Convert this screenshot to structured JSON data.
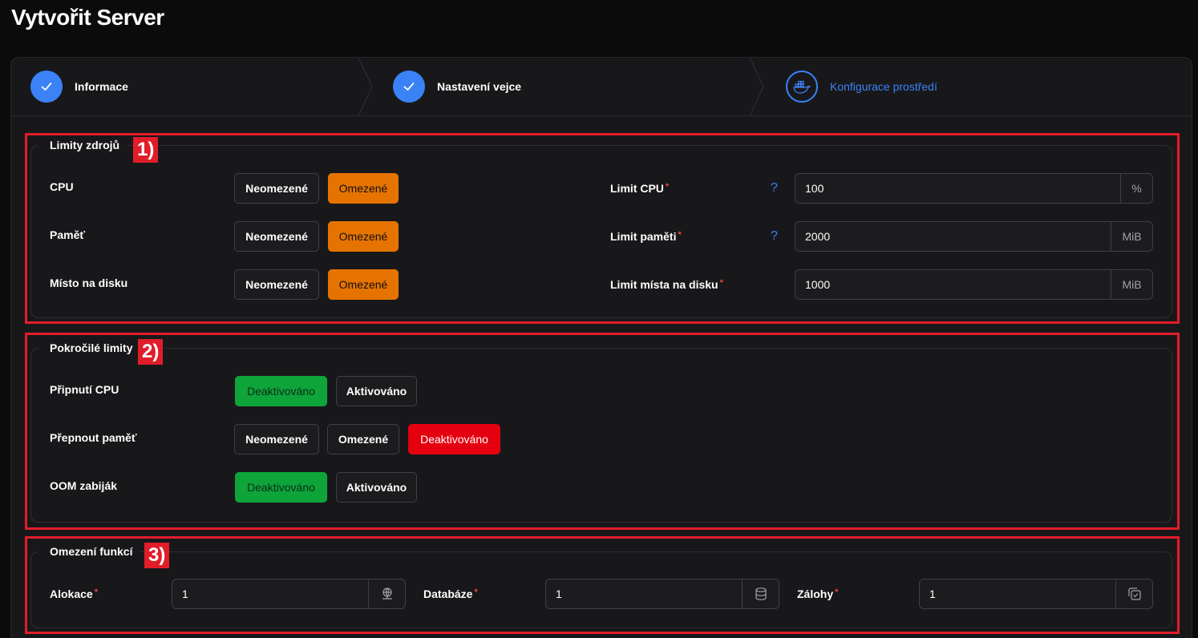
{
  "page_title": "Vytvořit Server",
  "steps": [
    {
      "label": "Informace",
      "status": "done",
      "icon": "check-icon"
    },
    {
      "label": "Nastavení vejce",
      "status": "done",
      "icon": "check-icon"
    },
    {
      "label": "Konfigurace prostředí",
      "status": "current",
      "icon": "docker-icon"
    }
  ],
  "annotations": {
    "one": "1)",
    "two": "2)",
    "three": "3)"
  },
  "resource_limits": {
    "legend": "Limity zdrojů",
    "rows": [
      {
        "label": "CPU",
        "unlimited": "Neomezené",
        "limited": "Omezené",
        "selected": "limited"
      },
      {
        "label": "Paměť",
        "unlimited": "Neomezené",
        "limited": "Omezené",
        "selected": "limited"
      },
      {
        "label": "Místo na disku",
        "unlimited": "Neomezené",
        "limited": "Omezené",
        "selected": "limited"
      }
    ],
    "fields": [
      {
        "label": "Limit CPU",
        "required": "*",
        "help": "?",
        "value": "100",
        "suffix": "%"
      },
      {
        "label": "Limit paměti",
        "required": "*",
        "help": "?",
        "value": "2000",
        "suffix": "MiB"
      },
      {
        "label": "Limit místa na disku",
        "required": "*",
        "help": "",
        "value": "1000",
        "suffix": "MiB"
      }
    ]
  },
  "advanced_limits": {
    "legend": "Pokročilé limity",
    "cpu_pinning": {
      "label": "Připnutí CPU",
      "opt1": "Deaktivováno",
      "opt2": "Aktivováno",
      "selected": "Deaktivováno"
    },
    "swap": {
      "label": "Přepnout paměť",
      "opt1": "Neomezené",
      "opt2": "Omezené",
      "opt3": "Deaktivováno",
      "selected": "Deaktivováno"
    },
    "oom": {
      "label": "OOM zabiják",
      "opt1": "Deaktivováno",
      "opt2": "Aktivováno",
      "selected": "Deaktivováno"
    }
  },
  "feature_limits": {
    "legend": "Omezení funkcí",
    "fields": [
      {
        "label": "Alokace",
        "required": "*",
        "value": "1",
        "icon": "network-icon"
      },
      {
        "label": "Databáze",
        "required": "*",
        "value": "1",
        "icon": "database-icon"
      },
      {
        "label": "Zálohy",
        "required": "*",
        "value": "1",
        "icon": "backup-icon"
      }
    ]
  },
  "colors": {
    "accent": "#3b82f6",
    "limited": "#e67300",
    "deactivated_green": "#0ea43a",
    "deactivated_red": "#e5000f",
    "annotation": "#e11d2a"
  }
}
